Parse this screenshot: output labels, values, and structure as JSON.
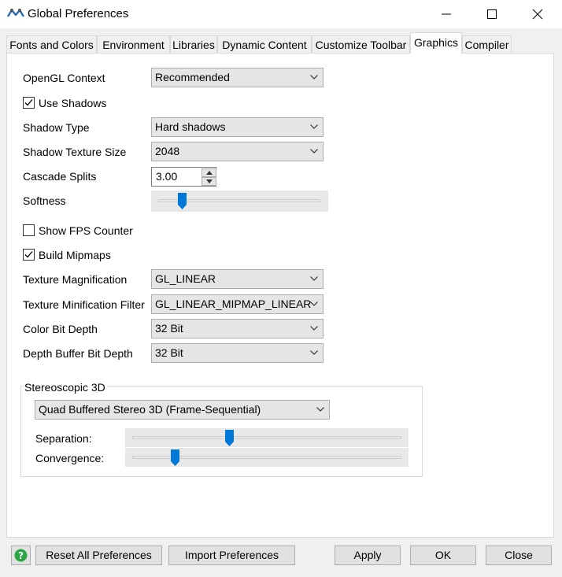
{
  "window": {
    "title": "Global Preferences",
    "icon": "flexsim-logo-icon",
    "controls": [
      "minimize-icon",
      "maximize-icon",
      "close-icon"
    ]
  },
  "tabs": [
    {
      "label": "Fonts and Colors",
      "active": false
    },
    {
      "label": "Environment",
      "active": false
    },
    {
      "label": "Libraries",
      "active": false
    },
    {
      "label": "Dynamic Content",
      "active": false
    },
    {
      "label": "Customize Toolbar",
      "active": false
    },
    {
      "label": "Graphics",
      "active": true
    },
    {
      "label": "Compiler",
      "active": false
    }
  ],
  "graphics": {
    "opengl_context": {
      "label": "OpenGL Context",
      "value": "Recommended"
    },
    "use_shadows": {
      "label": "Use Shadows",
      "checked": true
    },
    "shadow_type": {
      "label": "Shadow Type",
      "value": "Hard shadows"
    },
    "shadow_texture_size": {
      "label": "Shadow Texture Size",
      "value": "2048"
    },
    "cascade_splits": {
      "label": "Cascade Splits",
      "value": "3.00"
    },
    "softness": {
      "label": "Softness",
      "level": 0.15
    },
    "show_fps": {
      "label": "Show FPS Counter",
      "checked": false
    },
    "build_mipmaps": {
      "label": "Build Mipmaps",
      "checked": true
    },
    "texture_magnification": {
      "label": "Texture Magnification",
      "value": "GL_LINEAR"
    },
    "texture_minification": {
      "label": "Texture Minification Filter",
      "value": "GL_LINEAR_MIPMAP_LINEAR"
    },
    "color_bit_depth": {
      "label": "Color Bit Depth",
      "value": "32 Bit"
    },
    "depth_buffer_bit_depth": {
      "label": "Depth Buffer Bit Depth",
      "value": "32 Bit"
    }
  },
  "stereo": {
    "title": "Stereoscopic 3D",
    "mode": "Quad Buffered Stereo 3D (Frame-Sequential)",
    "separation": {
      "label": "Separation:",
      "level": 0.36
    },
    "convergence": {
      "label": "Convergence:",
      "level": 0.16
    }
  },
  "buttons": {
    "help_icon": "help-icon",
    "reset": "Reset All Preferences",
    "import": "Import Preferences",
    "apply": "Apply",
    "ok": "OK",
    "close": "Close"
  },
  "colors": {
    "accent": "#0078d7",
    "help_green": "#2aa744"
  }
}
